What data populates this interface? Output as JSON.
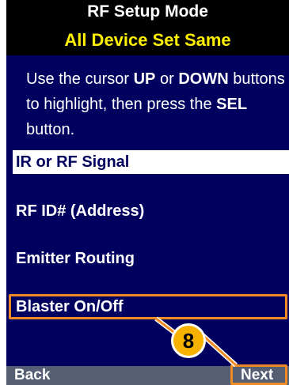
{
  "header": {
    "title": "RF Setup Mode",
    "subtitle": "All Device Set Same"
  },
  "instructions": {
    "text_1": "Use the cursor ",
    "up": "UP",
    "text_2": " or ",
    "down": "DOWN",
    "text_3": " buttons to highlight, then press the ",
    "sel": "SEL",
    "text_4": " button."
  },
  "menu": {
    "items": [
      {
        "label": "IR or RF Signal",
        "selected": true
      },
      {
        "label": "RF ID# (Address)",
        "selected": false
      },
      {
        "label": "Emitter Routing",
        "selected": false
      },
      {
        "label": "Blaster On/Off",
        "selected": false
      }
    ]
  },
  "callout": {
    "number": "8",
    "color": "#f08a24",
    "badge_color": "#f7b200"
  },
  "footer": {
    "back_label": "Back",
    "next_label": "Next"
  },
  "colors": {
    "background": "#00005e",
    "header": "#000000",
    "subtitle": "#ffef00",
    "footer": "#555e72"
  }
}
